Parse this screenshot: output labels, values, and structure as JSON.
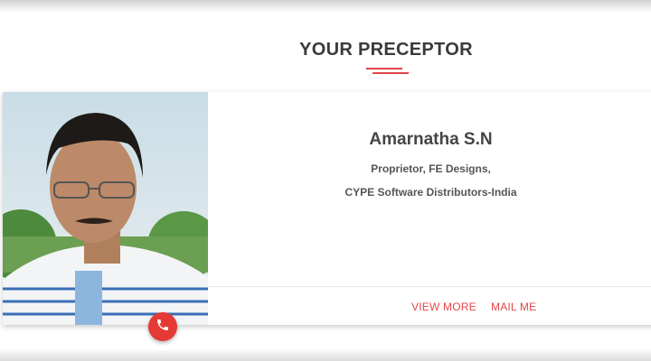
{
  "section": {
    "title": "YOUR PRECEPTOR"
  },
  "preceptor": {
    "name": "Amarnatha S.N",
    "role": "Proprietor, FE Designs,",
    "company": "CYPE Software Distributors-India"
  },
  "actions": {
    "view_more": "VIEW MORE",
    "mail_me": "MAIL ME"
  },
  "icons": {
    "call": "phone-icon"
  },
  "colors": {
    "accent": "#e2454a",
    "fab": "#e53935"
  }
}
